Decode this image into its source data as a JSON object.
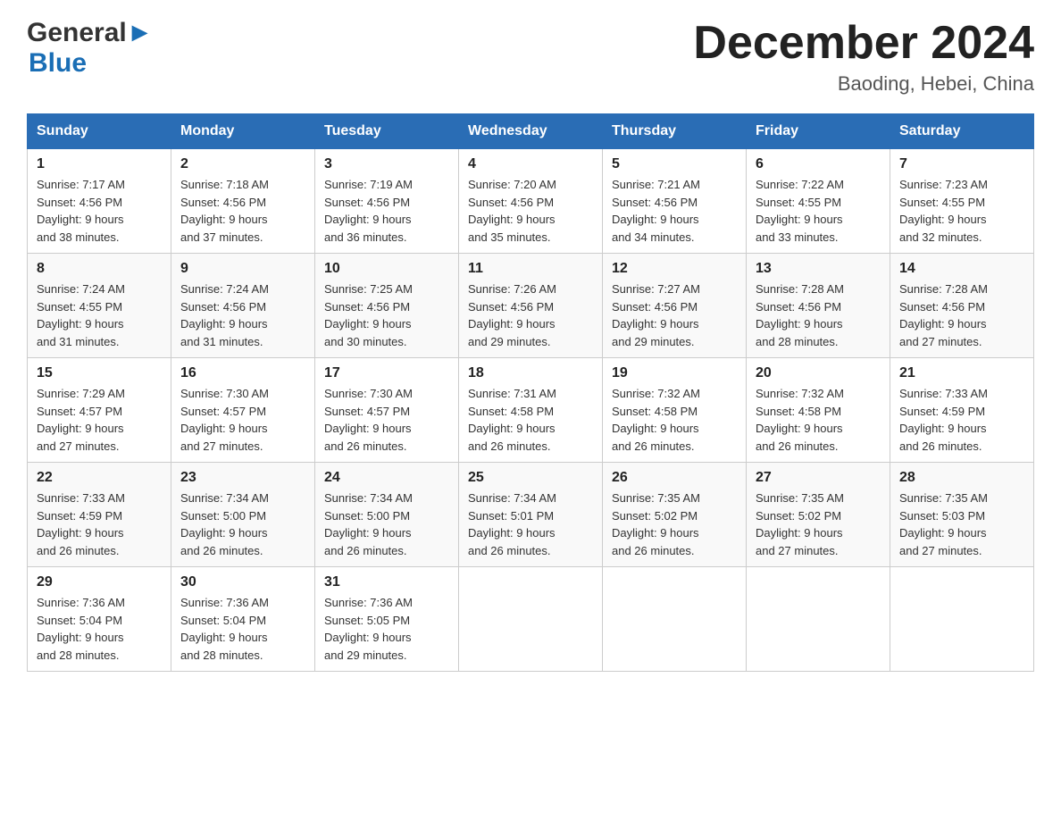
{
  "header": {
    "logo_general": "General",
    "logo_blue": "Blue",
    "month_title": "December 2024",
    "location": "Baoding, Hebei, China"
  },
  "weekdays": [
    "Sunday",
    "Monday",
    "Tuesday",
    "Wednesday",
    "Thursday",
    "Friday",
    "Saturday"
  ],
  "weeks": [
    [
      {
        "day": "1",
        "sunrise": "7:17 AM",
        "sunset": "4:56 PM",
        "daylight": "9 hours and 38 minutes."
      },
      {
        "day": "2",
        "sunrise": "7:18 AM",
        "sunset": "4:56 PM",
        "daylight": "9 hours and 37 minutes."
      },
      {
        "day": "3",
        "sunrise": "7:19 AM",
        "sunset": "4:56 PM",
        "daylight": "9 hours and 36 minutes."
      },
      {
        "day": "4",
        "sunrise": "7:20 AM",
        "sunset": "4:56 PM",
        "daylight": "9 hours and 35 minutes."
      },
      {
        "day": "5",
        "sunrise": "7:21 AM",
        "sunset": "4:56 PM",
        "daylight": "9 hours and 34 minutes."
      },
      {
        "day": "6",
        "sunrise": "7:22 AM",
        "sunset": "4:55 PM",
        "daylight": "9 hours and 33 minutes."
      },
      {
        "day": "7",
        "sunrise": "7:23 AM",
        "sunset": "4:55 PM",
        "daylight": "9 hours and 32 minutes."
      }
    ],
    [
      {
        "day": "8",
        "sunrise": "7:24 AM",
        "sunset": "4:55 PM",
        "daylight": "9 hours and 31 minutes."
      },
      {
        "day": "9",
        "sunrise": "7:24 AM",
        "sunset": "4:56 PM",
        "daylight": "9 hours and 31 minutes."
      },
      {
        "day": "10",
        "sunrise": "7:25 AM",
        "sunset": "4:56 PM",
        "daylight": "9 hours and 30 minutes."
      },
      {
        "day": "11",
        "sunrise": "7:26 AM",
        "sunset": "4:56 PM",
        "daylight": "9 hours and 29 minutes."
      },
      {
        "day": "12",
        "sunrise": "7:27 AM",
        "sunset": "4:56 PM",
        "daylight": "9 hours and 29 minutes."
      },
      {
        "day": "13",
        "sunrise": "7:28 AM",
        "sunset": "4:56 PM",
        "daylight": "9 hours and 28 minutes."
      },
      {
        "day": "14",
        "sunrise": "7:28 AM",
        "sunset": "4:56 PM",
        "daylight": "9 hours and 27 minutes."
      }
    ],
    [
      {
        "day": "15",
        "sunrise": "7:29 AM",
        "sunset": "4:57 PM",
        "daylight": "9 hours and 27 minutes."
      },
      {
        "day": "16",
        "sunrise": "7:30 AM",
        "sunset": "4:57 PM",
        "daylight": "9 hours and 27 minutes."
      },
      {
        "day": "17",
        "sunrise": "7:30 AM",
        "sunset": "4:57 PM",
        "daylight": "9 hours and 26 minutes."
      },
      {
        "day": "18",
        "sunrise": "7:31 AM",
        "sunset": "4:58 PM",
        "daylight": "9 hours and 26 minutes."
      },
      {
        "day": "19",
        "sunrise": "7:32 AM",
        "sunset": "4:58 PM",
        "daylight": "9 hours and 26 minutes."
      },
      {
        "day": "20",
        "sunrise": "7:32 AM",
        "sunset": "4:58 PM",
        "daylight": "9 hours and 26 minutes."
      },
      {
        "day": "21",
        "sunrise": "7:33 AM",
        "sunset": "4:59 PM",
        "daylight": "9 hours and 26 minutes."
      }
    ],
    [
      {
        "day": "22",
        "sunrise": "7:33 AM",
        "sunset": "4:59 PM",
        "daylight": "9 hours and 26 minutes."
      },
      {
        "day": "23",
        "sunrise": "7:34 AM",
        "sunset": "5:00 PM",
        "daylight": "9 hours and 26 minutes."
      },
      {
        "day": "24",
        "sunrise": "7:34 AM",
        "sunset": "5:00 PM",
        "daylight": "9 hours and 26 minutes."
      },
      {
        "day": "25",
        "sunrise": "7:34 AM",
        "sunset": "5:01 PM",
        "daylight": "9 hours and 26 minutes."
      },
      {
        "day": "26",
        "sunrise": "7:35 AM",
        "sunset": "5:02 PM",
        "daylight": "9 hours and 26 minutes."
      },
      {
        "day": "27",
        "sunrise": "7:35 AM",
        "sunset": "5:02 PM",
        "daylight": "9 hours and 27 minutes."
      },
      {
        "day": "28",
        "sunrise": "7:35 AM",
        "sunset": "5:03 PM",
        "daylight": "9 hours and 27 minutes."
      }
    ],
    [
      {
        "day": "29",
        "sunrise": "7:36 AM",
        "sunset": "5:04 PM",
        "daylight": "9 hours and 28 minutes."
      },
      {
        "day": "30",
        "sunrise": "7:36 AM",
        "sunset": "5:04 PM",
        "daylight": "9 hours and 28 minutes."
      },
      {
        "day": "31",
        "sunrise": "7:36 AM",
        "sunset": "5:05 PM",
        "daylight": "9 hours and 29 minutes."
      },
      null,
      null,
      null,
      null
    ]
  ]
}
